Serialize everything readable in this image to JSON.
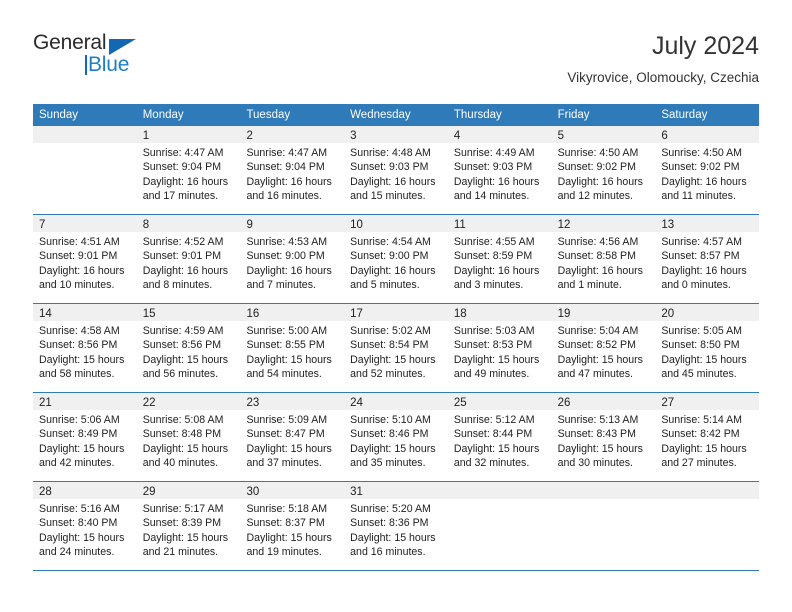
{
  "brand": {
    "name_part1": "General",
    "name_part2": "Blue",
    "triangle_icon": "triangle-icon",
    "accent_color": "#1368b1",
    "secondary_color": "#1f7fc4"
  },
  "header": {
    "title": "July 2024",
    "subtitle": "Vikyrovice, Olomoucky, Czechia"
  },
  "calendar": {
    "header_bg": "#2f7ab8",
    "day_band_bg": "#f0f0f0",
    "weekdays": [
      "Sunday",
      "Monday",
      "Tuesday",
      "Wednesday",
      "Thursday",
      "Friday",
      "Saturday"
    ],
    "weeks": [
      [
        {
          "day": "",
          "lines": []
        },
        {
          "day": "1",
          "lines": [
            "Sunrise: 4:47 AM",
            "Sunset: 9:04 PM",
            "Daylight: 16 hours",
            "and 17 minutes."
          ]
        },
        {
          "day": "2",
          "lines": [
            "Sunrise: 4:47 AM",
            "Sunset: 9:04 PM",
            "Daylight: 16 hours",
            "and 16 minutes."
          ]
        },
        {
          "day": "3",
          "lines": [
            "Sunrise: 4:48 AM",
            "Sunset: 9:03 PM",
            "Daylight: 16 hours",
            "and 15 minutes."
          ]
        },
        {
          "day": "4",
          "lines": [
            "Sunrise: 4:49 AM",
            "Sunset: 9:03 PM",
            "Daylight: 16 hours",
            "and 14 minutes."
          ]
        },
        {
          "day": "5",
          "lines": [
            "Sunrise: 4:50 AM",
            "Sunset: 9:02 PM",
            "Daylight: 16 hours",
            "and 12 minutes."
          ]
        },
        {
          "day": "6",
          "lines": [
            "Sunrise: 4:50 AM",
            "Sunset: 9:02 PM",
            "Daylight: 16 hours",
            "and 11 minutes."
          ]
        }
      ],
      [
        {
          "day": "7",
          "lines": [
            "Sunrise: 4:51 AM",
            "Sunset: 9:01 PM",
            "Daylight: 16 hours",
            "and 10 minutes."
          ]
        },
        {
          "day": "8",
          "lines": [
            "Sunrise: 4:52 AM",
            "Sunset: 9:01 PM",
            "Daylight: 16 hours",
            "and 8 minutes."
          ]
        },
        {
          "day": "9",
          "lines": [
            "Sunrise: 4:53 AM",
            "Sunset: 9:00 PM",
            "Daylight: 16 hours",
            "and 7 minutes."
          ]
        },
        {
          "day": "10",
          "lines": [
            "Sunrise: 4:54 AM",
            "Sunset: 9:00 PM",
            "Daylight: 16 hours",
            "and 5 minutes."
          ]
        },
        {
          "day": "11",
          "lines": [
            "Sunrise: 4:55 AM",
            "Sunset: 8:59 PM",
            "Daylight: 16 hours",
            "and 3 minutes."
          ]
        },
        {
          "day": "12",
          "lines": [
            "Sunrise: 4:56 AM",
            "Sunset: 8:58 PM",
            "Daylight: 16 hours",
            "and 1 minute."
          ]
        },
        {
          "day": "13",
          "lines": [
            "Sunrise: 4:57 AM",
            "Sunset: 8:57 PM",
            "Daylight: 16 hours",
            "and 0 minutes."
          ]
        }
      ],
      [
        {
          "day": "14",
          "lines": [
            "Sunrise: 4:58 AM",
            "Sunset: 8:56 PM",
            "Daylight: 15 hours",
            "and 58 minutes."
          ]
        },
        {
          "day": "15",
          "lines": [
            "Sunrise: 4:59 AM",
            "Sunset: 8:56 PM",
            "Daylight: 15 hours",
            "and 56 minutes."
          ]
        },
        {
          "day": "16",
          "lines": [
            "Sunrise: 5:00 AM",
            "Sunset: 8:55 PM",
            "Daylight: 15 hours",
            "and 54 minutes."
          ]
        },
        {
          "day": "17",
          "lines": [
            "Sunrise: 5:02 AM",
            "Sunset: 8:54 PM",
            "Daylight: 15 hours",
            "and 52 minutes."
          ]
        },
        {
          "day": "18",
          "lines": [
            "Sunrise: 5:03 AM",
            "Sunset: 8:53 PM",
            "Daylight: 15 hours",
            "and 49 minutes."
          ]
        },
        {
          "day": "19",
          "lines": [
            "Sunrise: 5:04 AM",
            "Sunset: 8:52 PM",
            "Daylight: 15 hours",
            "and 47 minutes."
          ]
        },
        {
          "day": "20",
          "lines": [
            "Sunrise: 5:05 AM",
            "Sunset: 8:50 PM",
            "Daylight: 15 hours",
            "and 45 minutes."
          ]
        }
      ],
      [
        {
          "day": "21",
          "lines": [
            "Sunrise: 5:06 AM",
            "Sunset: 8:49 PM",
            "Daylight: 15 hours",
            "and 42 minutes."
          ]
        },
        {
          "day": "22",
          "lines": [
            "Sunrise: 5:08 AM",
            "Sunset: 8:48 PM",
            "Daylight: 15 hours",
            "and 40 minutes."
          ]
        },
        {
          "day": "23",
          "lines": [
            "Sunrise: 5:09 AM",
            "Sunset: 8:47 PM",
            "Daylight: 15 hours",
            "and 37 minutes."
          ]
        },
        {
          "day": "24",
          "lines": [
            "Sunrise: 5:10 AM",
            "Sunset: 8:46 PM",
            "Daylight: 15 hours",
            "and 35 minutes."
          ]
        },
        {
          "day": "25",
          "lines": [
            "Sunrise: 5:12 AM",
            "Sunset: 8:44 PM",
            "Daylight: 15 hours",
            "and 32 minutes."
          ]
        },
        {
          "day": "26",
          "lines": [
            "Sunrise: 5:13 AM",
            "Sunset: 8:43 PM",
            "Daylight: 15 hours",
            "and 30 minutes."
          ]
        },
        {
          "day": "27",
          "lines": [
            "Sunrise: 5:14 AM",
            "Sunset: 8:42 PM",
            "Daylight: 15 hours",
            "and 27 minutes."
          ]
        }
      ],
      [
        {
          "day": "28",
          "lines": [
            "Sunrise: 5:16 AM",
            "Sunset: 8:40 PM",
            "Daylight: 15 hours",
            "and 24 minutes."
          ]
        },
        {
          "day": "29",
          "lines": [
            "Sunrise: 5:17 AM",
            "Sunset: 8:39 PM",
            "Daylight: 15 hours",
            "and 21 minutes."
          ]
        },
        {
          "day": "30",
          "lines": [
            "Sunrise: 5:18 AM",
            "Sunset: 8:37 PM",
            "Daylight: 15 hours",
            "and 19 minutes."
          ]
        },
        {
          "day": "31",
          "lines": [
            "Sunrise: 5:20 AM",
            "Sunset: 8:36 PM",
            "Daylight: 15 hours",
            "and 16 minutes."
          ]
        },
        {
          "day": "",
          "lines": []
        },
        {
          "day": "",
          "lines": []
        },
        {
          "day": "",
          "lines": []
        }
      ]
    ]
  }
}
